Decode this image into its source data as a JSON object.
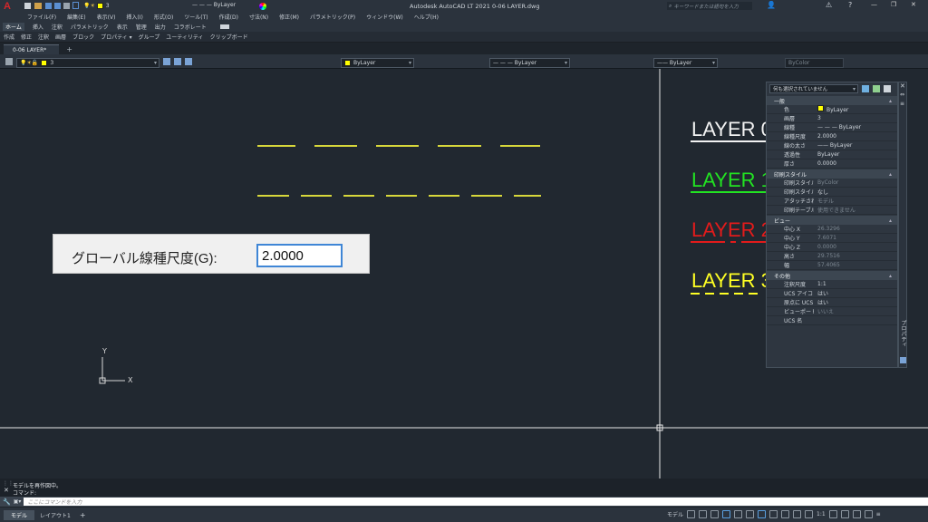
{
  "title": {
    "window_title": "Autodesk AutoCAD LT 2021    0-06 LAYER.dwg",
    "qa_layer": "3",
    "qa_linetype": "— — — ByLayer",
    "search_placeholder": "キーワードまたは語句を入力",
    "window_buttons": [
      "—",
      "❐",
      "✕"
    ]
  },
  "menu": [
    "ファイル(F)",
    "編集(E)",
    "表示(V)",
    "挿入(I)",
    "形式(O)",
    "ツール(T)",
    "作成(D)",
    "寸法(N)",
    "修正(M)",
    "パラメトリック(P)",
    "ウィンドウ(W)",
    "ヘルプ(H)"
  ],
  "ribbon_tabs": [
    "ホーム",
    "挿入",
    "注釈",
    "パラメトリック",
    "表示",
    "管理",
    "出力",
    "コラボレート"
  ],
  "ribbon_panels": [
    "作成",
    "修正",
    "注釈",
    "画層",
    "ブロック",
    "プロパティ ▾",
    "グループ",
    "ユーティリティ",
    "クリップボード"
  ],
  "file_tabs": [
    {
      "label": "0-06 LAYER*"
    }
  ],
  "file_tab_add": "+",
  "props_toolbar": {
    "layer": "3",
    "color": "ByLayer",
    "linetype": "— — — ByLayer",
    "lineweight": "—— ByLayer",
    "plotstyle": "ByColor"
  },
  "canvas": {
    "layer_labels": [
      {
        "text": "LAYER 0",
        "color": "#f2f2f2"
      },
      {
        "text": "LAYER 1",
        "color": "#22e322"
      },
      {
        "text": "LAYER 2",
        "color": "#e21b1b"
      },
      {
        "text": "LAYER 3",
        "color": "#ffff24"
      }
    ],
    "ucs_x": "X",
    "ucs_y": "Y"
  },
  "dialog": {
    "label": "グローバル線種尺度(G):",
    "value": "2.0000"
  },
  "properties": {
    "selection": "何も選択されていません",
    "sections": [
      {
        "title": "一般",
        "rows": [
          {
            "k": "色",
            "v": "ByLayer",
            "swatch": true
          },
          {
            "k": "画層",
            "v": "3"
          },
          {
            "k": "線種",
            "v": "— — — ByLayer"
          },
          {
            "k": "線種尺度",
            "v": "2.0000"
          },
          {
            "k": "線の太さ",
            "v": "—— ByLayer"
          },
          {
            "k": "透過性",
            "v": "ByLayer"
          },
          {
            "k": "厚さ",
            "v": "0.0000"
          }
        ]
      },
      {
        "title": "印刷スタイル",
        "rows": [
          {
            "k": "印刷スタイル",
            "v": "ByColor",
            "dim": true
          },
          {
            "k": "印刷スタイル テ...",
            "v": "なし"
          },
          {
            "k": "アタッチされた印...",
            "v": "モデル",
            "dim": true
          },
          {
            "k": "印刷テーブルのタ...",
            "v": "使用できません",
            "dim": true
          }
        ]
      },
      {
        "title": "ビュー",
        "rows": [
          {
            "k": "中心 X",
            "v": "26.3296",
            "dim": true
          },
          {
            "k": "中心 Y",
            "v": "7.6071",
            "dim": true
          },
          {
            "k": "中心 Z",
            "v": "0.0000",
            "dim": true
          },
          {
            "k": "高さ",
            "v": "29.7516",
            "dim": true
          },
          {
            "k": "幅",
            "v": "57.4065",
            "dim": true
          }
        ]
      },
      {
        "title": "その他",
        "rows": [
          {
            "k": "注釈尺度",
            "v": "1:1"
          },
          {
            "k": "UCS アイコン オン",
            "v": "はい"
          },
          {
            "k": "原点に UCS アイ...",
            "v": "はい"
          },
          {
            "k": "ビューポートごとの...",
            "v": "いいえ",
            "dim": true
          },
          {
            "k": "UCS 名",
            "v": ""
          }
        ]
      }
    ],
    "side_label": "プロパティ"
  },
  "command": {
    "history": [
      "モデルを再作図中。",
      "コマンド:"
    ],
    "placeholder": "ここにコマンドを入力"
  },
  "status": {
    "layout_tabs": [
      "モデル",
      "レイアウト1"
    ],
    "add": "+",
    "model_label": "モデル",
    "scale": "1:1"
  },
  "colors": {
    "accent": "#3f86d6",
    "yellow_linetype": "#d7d73b",
    "background": "#212830"
  }
}
